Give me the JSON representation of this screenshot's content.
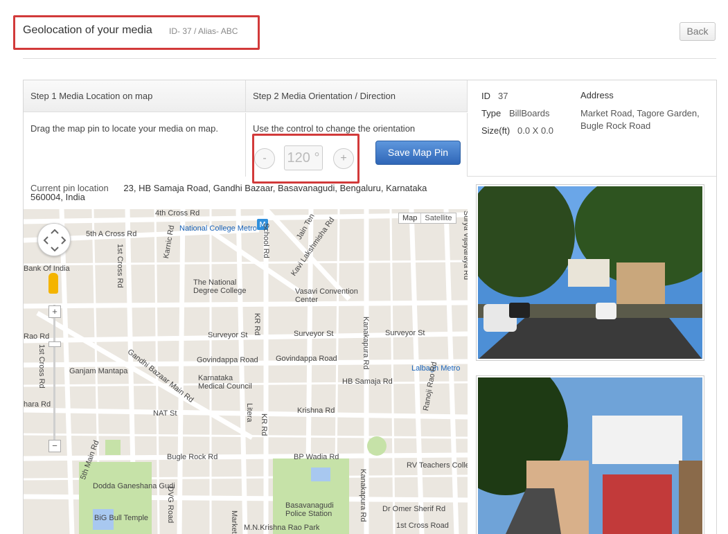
{
  "header": {
    "title": "Geolocation of your media",
    "subtitle": "ID- 37 / Alias- ABC",
    "back_label": "Back"
  },
  "steps": {
    "step1_title": "Step 1 Media Location on map",
    "step1_text": "Drag the map pin to locate your media on map.",
    "step2_title": "Step 2 Media Orientation / Direction",
    "step2_text": "Use the control to change the orientation",
    "minus_label": "-",
    "plus_label": "+",
    "orientation_value": "120 °",
    "save_label": "Save Map Pin"
  },
  "info": {
    "id_label": "ID",
    "id_value": "37",
    "type_label": "Type",
    "type_value": "BillBoards",
    "size_label": "Size(ft)",
    "size_value": "0.0 X 0.0",
    "address_label": "Address",
    "address_value": "Market Road, Tagore Garden, Bugle Rock Road"
  },
  "pin": {
    "label": "Current pin location",
    "address": "23, HB Samaja Road, Gandhi Bazaar, Basavanagudi, Bengaluru, Karnataka 560004, India"
  },
  "map": {
    "map_label": "Map",
    "satellite_label": "Satellite",
    "zoom_in": "+",
    "zoom_out": "−",
    "labels": {
      "cross4": "4th Cross Rd",
      "cross5a": "5th A Cross Rd",
      "national_metro": "National College Metro",
      "school_rd": "School Rd",
      "jain_temple": "Jain Ten",
      "kavi": "Kavi Lakshmisha Rd",
      "surya": "Surya Vijayaraya Rd",
      "bank": "Bank Of India",
      "cross1": "1st Cross Rd",
      "karnic": "Karnic Rd",
      "natcollege": "The National Degree College",
      "vasavi": "Vasavi Convention Center",
      "rao": "Rao Rd",
      "surveyor1": "Surveyor St",
      "surveyor2": "Surveyor St",
      "surveyor3": "Surveyor St",
      "kr": "KR Rd",
      "kanakapura": "Kanakapura Rd",
      "govindappa1": "Govindappa Road",
      "govindappa2": "Govindappa Road",
      "ganjam": "Ganjam Mantapa",
      "gandhi": "Gandhi Bazaar Main Rd",
      "karnataka": "Karnataka Medical Council",
      "hbsamaja": "HB Samaja Rd",
      "lalbagh": "Lalbagh Metro",
      "hara": "hara Rd",
      "nat": "NAT St",
      "krishna": "Krishna Rd",
      "ranoji": "Ranoji Rao Rd",
      "bugle": "Bugle Rock Rd",
      "bpwadia": "BP Wadia Rd",
      "rvteachers": "RV Teachers Colle",
      "dodda": "Dodda Ganeshana Gudi",
      "dvg": "DVG Road",
      "basava": "Basavanagudi Police Station",
      "omer": "Dr Omer Sherif Rd",
      "bigbull": "BiG Bull Temple",
      "mnkrishna": "M.N.Krishna Rao Park",
      "firstcross": "1st Cross Road",
      "fifthmain": "5th Main Rd",
      "market": "Market",
      "literat": "Litera"
    }
  },
  "colors": {
    "highlight": "#d23a3a",
    "primary": "#3a72c4",
    "metro": "#2f8fdc"
  }
}
